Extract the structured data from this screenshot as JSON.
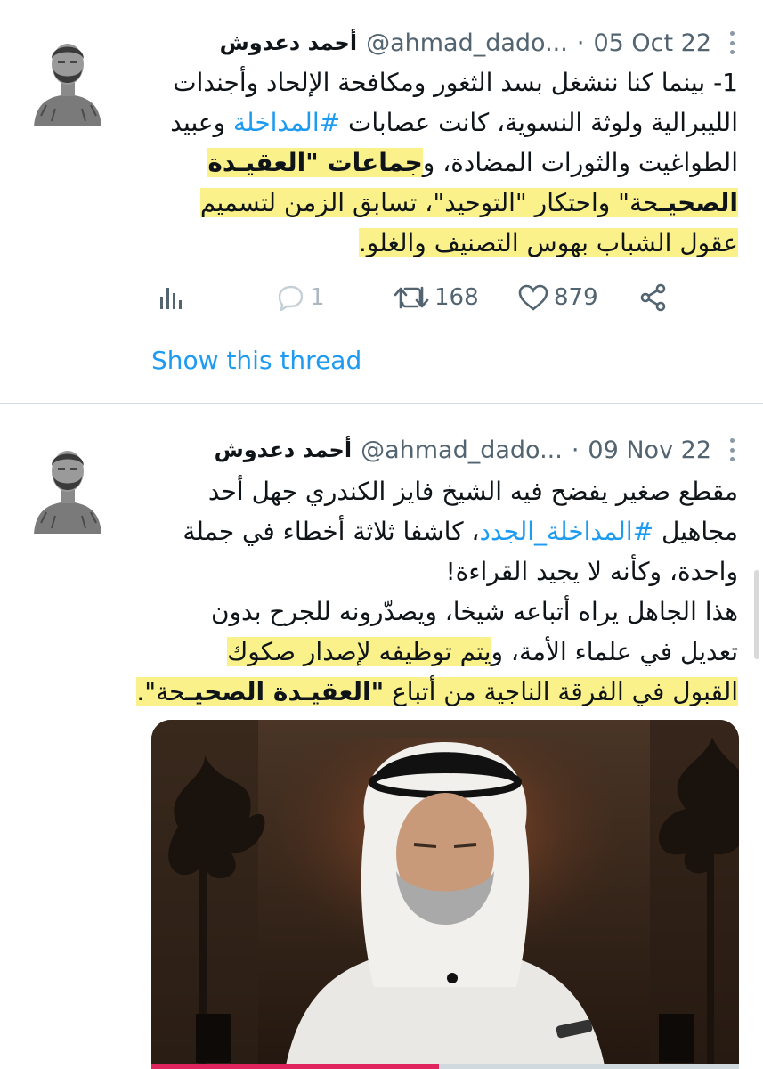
{
  "tweets": [
    {
      "author": {
        "display_name": "أحمد دعدوش",
        "handle": "@ahmad_dado...",
        "avatar_icon": "avatar-photo"
      },
      "separator": "·",
      "date": "05 Oct 22",
      "text": {
        "l1": "1- بينما كنا ننشغل بسد الثغور ومكافحة الإلحاد وأجندات",
        "l2": "الليبرالية ولوثة النسوية، كانت عصابات",
        "l2_hashtag": "#المداخلة",
        "l2_end": "وعبيد",
        "l3": "الطواغيت والثورات المضادة، و",
        "l3_hl": "جماعات \"العقيـدة",
        "l4_hl_bold": "الصحيـ",
        "l4_hl": "حة\" واحتكار \"التوحيد\"، تسابق الزمن لتسميم",
        "l5_hl": "عقول الشباب بهوس التصنيف والغلو."
      },
      "actions": {
        "analytics_icon": "bar-chart-icon",
        "reply_icon": "reply-icon",
        "reply_count": "1",
        "retweet_icon": "retweet-icon",
        "retweet_count": "168",
        "like_icon": "heart-icon",
        "like_count": "879",
        "share_icon": "share-icon"
      },
      "show_thread": "Show this thread"
    },
    {
      "author": {
        "display_name": "أحمد دعدوش",
        "handle": "@ahmad_dado...",
        "avatar_icon": "avatar-photo"
      },
      "separator": "·",
      "date": "09 Nov 22",
      "text": {
        "l1": "مقطع صغير يفضح فيه الشيخ فايز الكندري جهل أحد",
        "l2_start": "مجاهيل",
        "l2_hashtag": "#المداخلة_الجدد",
        "l2_end": "، كاشفا ثلاثة أخطاء في جملة",
        "l3": "واحدة، وكأنه لا يجيد القراءة!",
        "l4": "هذا الجاهل يراه أتباعه شيخا، ويصدّرونه للجرح بدون",
        "l5": "تعديل في علماء الأمة، و",
        "l5_hl": "يتم توظيفه لإصدار صكوك",
        "l6_hl": "القبول في الفرقة الناجية من أتباع ",
        "l6_hl_bold": "\"العقيـدة الصحيـ",
        "l6_hl_end": "حة\"."
      },
      "media": {
        "type": "video",
        "progress": 0.49,
        "accent": "#e0245e"
      }
    }
  ],
  "colors": {
    "link": "#1d9bf0",
    "highlight": "#faf18a",
    "muted": "#536471"
  }
}
